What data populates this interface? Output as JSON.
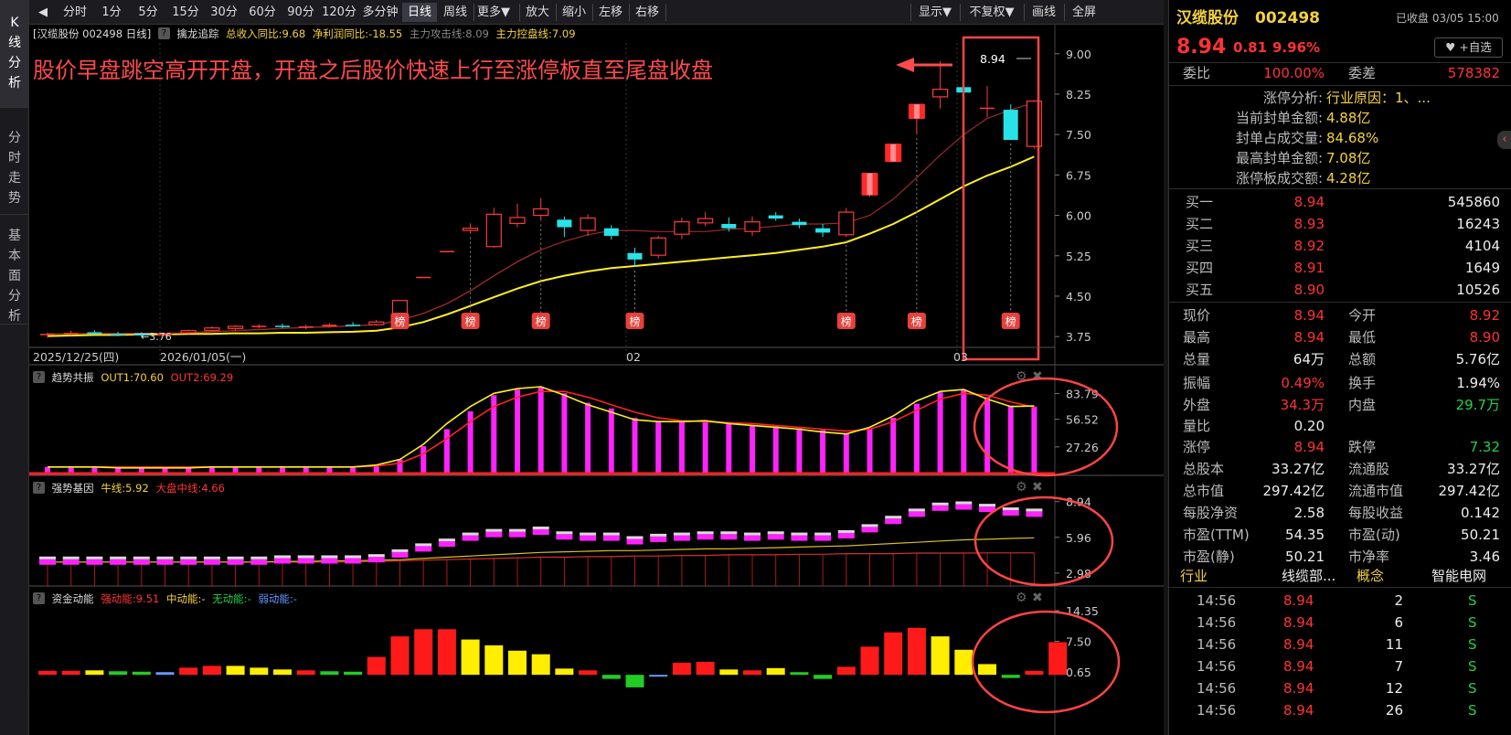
{
  "left_tabs": [
    {
      "chars": [
        "K",
        "线",
        "分",
        "析"
      ],
      "active": true
    },
    {
      "chars": [
        "分",
        "时",
        "走",
        "势"
      ],
      "active": false
    },
    {
      "chars": [
        "基",
        "本",
        "面",
        "分",
        "析"
      ],
      "active": false
    }
  ],
  "toolbar": {
    "back": "◀",
    "periods": [
      "分时",
      "1分",
      "5分",
      "15分",
      "30分",
      "60分",
      "90分",
      "120分",
      "多分钟",
      "日线",
      "周线",
      "更多▼"
    ],
    "active_period": "日线",
    "tools": [
      "放大",
      "缩小",
      "左移",
      "右移"
    ],
    "right": [
      "显示▼",
      "不复权▼",
      "画线",
      "全屏"
    ]
  },
  "main_pane": {
    "stock_label": "[汉缆股份 002498 日线]",
    "indicator": "擒龙追踪",
    "items": [
      {
        "text": "总收入同比:9.68",
        "color": "#f5d33d"
      },
      {
        "text": "净利润同比:-18.55",
        "color": "#f5d33d"
      },
      {
        "text": "主力攻击线:8.09",
        "color": "#888888"
      },
      {
        "text": "主力控盘线:7.09",
        "color": "#f5d33d"
      }
    ],
    "annotation": "股价早盘跳空高开开盘，开盘之后股价快速上行至涨停板直至尾盘收盘",
    "price_label": "8.94",
    "low_label": "3.76",
    "axis": [
      "9.00",
      "8.25",
      "7.50",
      "6.75",
      "6.00",
      "5.25",
      "4.50",
      "3.75"
    ],
    "dates": [
      "2025/12/25(四)",
      "2026/01/05(一)",
      "02",
      "03"
    ],
    "badge": "榜"
  },
  "pane2": {
    "name": "趋势共振",
    "out1": "OUT1:70.60",
    "out2": "OUT2:69.29",
    "axis": [
      "83.79",
      "56.52",
      "27.26"
    ]
  },
  "pane3": {
    "name": "强势基因",
    "l1": "牛线:5.92",
    "l2": "大盘中线:4.66",
    "axis": [
      "8.94",
      "5.96",
      "2.98"
    ]
  },
  "pane4": {
    "name": "资金动能",
    "l1": "强动能:9.51",
    "l2": "中动能:-",
    "l3": "无动能:-",
    "l4": "弱动能:-",
    "axis": [
      "14.35",
      "7.50",
      "0.65"
    ]
  },
  "chart_data": {
    "type": "candlestick",
    "candles": [
      {
        "o": 3.78,
        "h": 3.82,
        "l": 3.73,
        "c": 3.8
      },
      {
        "o": 3.8,
        "h": 3.86,
        "l": 3.77,
        "c": 3.82
      },
      {
        "o": 3.83,
        "h": 3.87,
        "l": 3.79,
        "c": 3.8
      },
      {
        "o": 3.8,
        "h": 3.84,
        "l": 3.76,
        "c": 3.79
      },
      {
        "o": 3.8,
        "h": 3.83,
        "l": 3.74,
        "c": 3.77
      },
      {
        "o": 3.78,
        "h": 3.82,
        "l": 3.76,
        "c": 3.8
      },
      {
        "o": 3.82,
        "h": 3.88,
        "l": 3.8,
        "c": 3.86
      },
      {
        "o": 3.86,
        "h": 3.94,
        "l": 3.84,
        "c": 3.91
      },
      {
        "o": 3.9,
        "h": 3.96,
        "l": 3.86,
        "c": 3.94
      },
      {
        "o": 3.93,
        "h": 3.98,
        "l": 3.9,
        "c": 3.95
      },
      {
        "o": 3.95,
        "h": 3.99,
        "l": 3.91,
        "c": 3.93
      },
      {
        "o": 3.92,
        "h": 3.97,
        "l": 3.88,
        "c": 3.94
      },
      {
        "o": 3.94,
        "h": 4.0,
        "l": 3.92,
        "c": 3.97
      },
      {
        "o": 3.97,
        "h": 4.02,
        "l": 3.94,
        "c": 3.96
      },
      {
        "o": 3.97,
        "h": 4.06,
        "l": 3.95,
        "c": 4.02
      },
      {
        "o": 4.1,
        "h": 4.42,
        "l": 4.08,
        "c": 4.42
      },
      {
        "o": 4.86,
        "h": 4.86,
        "l": 4.86,
        "c": 4.86
      },
      {
        "o": 5.34,
        "h": 5.34,
        "l": 5.34,
        "c": 5.34
      },
      {
        "o": 5.72,
        "h": 5.85,
        "l": 5.66,
        "c": 5.76
      },
      {
        "o": 5.42,
        "h": 6.14,
        "l": 5.4,
        "c": 6.02
      },
      {
        "o": 5.85,
        "h": 6.22,
        "l": 5.78,
        "c": 5.96
      },
      {
        "o": 6.0,
        "h": 6.32,
        "l": 5.9,
        "c": 6.12
      },
      {
        "o": 5.92,
        "h": 5.98,
        "l": 5.6,
        "c": 5.78
      },
      {
        "o": 5.72,
        "h": 6.02,
        "l": 5.62,
        "c": 5.95
      },
      {
        "o": 5.76,
        "h": 5.82,
        "l": 5.55,
        "c": 5.62
      },
      {
        "o": 5.3,
        "h": 5.4,
        "l": 5.04,
        "c": 5.18
      },
      {
        "o": 5.26,
        "h": 5.62,
        "l": 5.2,
        "c": 5.58
      },
      {
        "o": 5.65,
        "h": 5.96,
        "l": 5.56,
        "c": 5.88
      },
      {
        "o": 5.86,
        "h": 6.06,
        "l": 5.8,
        "c": 5.94
      },
      {
        "o": 5.84,
        "h": 5.96,
        "l": 5.7,
        "c": 5.76
      },
      {
        "o": 5.7,
        "h": 5.98,
        "l": 5.62,
        "c": 5.88
      },
      {
        "o": 6.0,
        "h": 6.06,
        "l": 5.9,
        "c": 5.94
      },
      {
        "o": 5.88,
        "h": 5.94,
        "l": 5.76,
        "c": 5.82
      },
      {
        "o": 5.76,
        "h": 5.84,
        "l": 5.6,
        "c": 5.68
      },
      {
        "o": 5.64,
        "h": 6.14,
        "l": 5.6,
        "c": 6.06
      },
      {
        "o": 6.38,
        "h": 6.78,
        "l": 6.34,
        "c": 6.78
      },
      {
        "o": 7.0,
        "h": 7.32,
        "l": 7.0,
        "c": 7.32
      },
      {
        "o": 7.8,
        "h": 8.06,
        "l": 7.5,
        "c": 8.06
      },
      {
        "o": 8.2,
        "h": 8.86,
        "l": 7.98,
        "c": 8.34
      },
      {
        "o": 8.38,
        "h": 8.44,
        "l": 8.16,
        "c": 8.28
      },
      {
        "o": 7.98,
        "h": 8.4,
        "l": 7.82,
        "c": 8.0
      },
      {
        "o": 7.96,
        "h": 8.06,
        "l": 7.4,
        "c": 7.4
      },
      {
        "o": 7.28,
        "h": 8.14,
        "l": 7.24,
        "c": 8.12
      }
    ],
    "ma_grey": [
      3.8,
      3.8,
      3.81,
      3.81,
      3.81,
      3.81,
      3.82,
      3.84,
      3.86,
      3.88,
      3.9,
      3.92,
      3.93,
      3.95,
      3.97,
      4.05,
      4.18,
      4.36,
      4.6,
      4.88,
      5.14,
      5.36,
      5.52,
      5.64,
      5.72,
      5.72,
      5.7,
      5.7,
      5.7,
      5.74,
      5.76,
      5.8,
      5.84,
      5.84,
      5.86,
      6.0,
      6.3,
      6.7,
      7.12,
      7.5,
      7.8,
      7.96,
      8.09
    ],
    "ma_yellow": [
      3.76,
      3.77,
      3.78,
      3.78,
      3.79,
      3.79,
      3.8,
      3.8,
      3.81,
      3.81,
      3.82,
      3.82,
      3.83,
      3.84,
      3.86,
      3.92,
      4.02,
      4.16,
      4.32,
      4.48,
      4.64,
      4.78,
      4.88,
      4.96,
      5.02,
      5.06,
      5.1,
      5.14,
      5.18,
      5.22,
      5.26,
      5.3,
      5.36,
      5.42,
      5.5,
      5.66,
      5.84,
      6.06,
      6.3,
      6.54,
      6.74,
      6.9,
      7.09
    ],
    "badges_at": [
      15,
      18,
      21,
      25,
      34,
      37,
      41
    ],
    "trend": {
      "bars": [
        6,
        6,
        6,
        5,
        5,
        5,
        5,
        6,
        6,
        6,
        6,
        6,
        6,
        6,
        8,
        14,
        28,
        46,
        65,
        82,
        88,
        91,
        84,
        74,
        68,
        58,
        54,
        54,
        55,
        52,
        50,
        49,
        47,
        45,
        42,
        47,
        58,
        73,
        85,
        88,
        80,
        71,
        70
      ],
      "out1": [
        6,
        6,
        6,
        5,
        5,
        5,
        5,
        6,
        6,
        6,
        6,
        6,
        6,
        6,
        8,
        14,
        30,
        52,
        70,
        84,
        89,
        91,
        82,
        72,
        64,
        56,
        54,
        54,
        55,
        52,
        50,
        48,
        46,
        43,
        41,
        48,
        60,
        76,
        86,
        88,
        78,
        70,
        70.6
      ],
      "out2": [
        6,
        6,
        6,
        6,
        6,
        6,
        6,
        6,
        6,
        6,
        6,
        6,
        6,
        6,
        7,
        10,
        20,
        36,
        54,
        70,
        80,
        86,
        86,
        80,
        72,
        64,
        58,
        55,
        54,
        53,
        52,
        50,
        48,
        46,
        44,
        46,
        54,
        66,
        78,
        84,
        82,
        75,
        69.3
      ]
    },
    "gene": {
      "boxes": [
        3.9,
        3.9,
        3.9,
        3.9,
        3.9,
        3.9,
        3.9,
        3.9,
        3.9,
        3.9,
        4.0,
        4.0,
        4.0,
        4.0,
        4.1,
        4.5,
        5.0,
        5.4,
        5.9,
        6.2,
        6.2,
        6.4,
        6.0,
        5.9,
        5.9,
        5.6,
        5.8,
        5.9,
        6.0,
        6.0,
        5.9,
        6.0,
        5.9,
        5.9,
        6.1,
        6.6,
        7.3,
        7.9,
        8.4,
        8.5,
        8.3,
        8.0,
        7.9
      ],
      "bull": [
        3.9,
        3.9,
        3.9,
        3.9,
        3.9,
        3.9,
        3.9,
        3.9,
        3.9,
        3.9,
        3.95,
        3.95,
        4.0,
        4.0,
        4.05,
        4.1,
        4.2,
        4.3,
        4.4,
        4.5,
        4.6,
        4.7,
        4.75,
        4.8,
        4.85,
        4.85,
        4.9,
        4.95,
        5.0,
        5.0,
        5.05,
        5.1,
        5.15,
        5.2,
        5.25,
        5.35,
        5.45,
        5.55,
        5.65,
        5.75,
        5.8,
        5.87,
        5.92
      ],
      "market": [
        3.9,
        3.9,
        3.9,
        3.9,
        3.9,
        3.9,
        3.9,
        3.9,
        3.9,
        3.9,
        3.9,
        3.9,
        3.9,
        3.9,
        3.95,
        4.0,
        4.05,
        4.1,
        4.15,
        4.2,
        4.25,
        4.3,
        4.3,
        4.35,
        4.35,
        4.4,
        4.4,
        4.45,
        4.45,
        4.5,
        4.5,
        4.5,
        4.55,
        4.55,
        4.6,
        4.6,
        4.6,
        4.65,
        4.65,
        4.65,
        4.66,
        4.66,
        4.66
      ]
    },
    "energy": [
      {
        "v": 0.9,
        "c": "#ff1a1a"
      },
      {
        "v": 0.9,
        "c": "#ff1a1a"
      },
      {
        "v": 1.0,
        "c": "#ffee00"
      },
      {
        "v": 0.8,
        "c": "#22cc22"
      },
      {
        "v": 0.7,
        "c": "#22cc22"
      },
      {
        "v": 0.6,
        "c": "#6699ff"
      },
      {
        "v": 1.6,
        "c": "#ff1a1a"
      },
      {
        "v": 2.0,
        "c": "#ff1a1a"
      },
      {
        "v": 2.0,
        "c": "#ffee00"
      },
      {
        "v": 1.6,
        "c": "#ffee00"
      },
      {
        "v": 1.2,
        "c": "#ffee00"
      },
      {
        "v": 1.0,
        "c": "#ff1a1a"
      },
      {
        "v": 0.8,
        "c": "#22cc22"
      },
      {
        "v": 0.7,
        "c": "#22cc22"
      },
      {
        "v": 4.0,
        "c": "#ff1a1a"
      },
      {
        "v": 8.6,
        "c": "#ff1a1a"
      },
      {
        "v": 10.2,
        "c": "#ff1a1a"
      },
      {
        "v": 10.2,
        "c": "#ff1a1a"
      },
      {
        "v": 7.9,
        "c": "#ffee00"
      },
      {
        "v": 6.6,
        "c": "#ffee00"
      },
      {
        "v": 5.4,
        "c": "#ffee00"
      },
      {
        "v": 4.6,
        "c": "#ffee00"
      },
      {
        "v": 1.4,
        "c": "#ffee00"
      },
      {
        "v": 1.0,
        "c": "#ff1a1a"
      },
      {
        "v": -0.9,
        "c": "#22cc22"
      },
      {
        "v": -2.8,
        "c": "#22cc22"
      },
      {
        "v": -0.4,
        "c": "#6699ff"
      },
      {
        "v": 2.7,
        "c": "#ff1a1a"
      },
      {
        "v": 2.9,
        "c": "#ff1a1a"
      },
      {
        "v": 1.2,
        "c": "#ffee00"
      },
      {
        "v": 1.0,
        "c": "#ff1a1a"
      },
      {
        "v": 1.5,
        "c": "#ffee00"
      },
      {
        "v": 0.6,
        "c": "#22cc22"
      },
      {
        "v": -0.9,
        "c": "#22cc22"
      },
      {
        "v": 1.8,
        "c": "#ff1a1a"
      },
      {
        "v": 6.3,
        "c": "#ff1a1a"
      },
      {
        "v": 9.5,
        "c": "#ff1a1a"
      },
      {
        "v": 10.5,
        "c": "#ff1a1a"
      },
      {
        "v": 8.6,
        "c": "#ffee00"
      },
      {
        "v": 5.6,
        "c": "#ffee00"
      },
      {
        "v": 2.4,
        "c": "#ffee00"
      },
      {
        "v": -0.7,
        "c": "#22cc22"
      },
      {
        "v": 0.9,
        "c": "#ff1a1a"
      },
      {
        "v": 7.3,
        "c": "#ff1a1a"
      }
    ]
  },
  "quote": {
    "name": "汉缆股份",
    "code": "002498",
    "status": "已收盘 03/05 15:00",
    "price": "8.94",
    "change": "0.81",
    "change_pct": "9.96%",
    "add_fav": "+自选",
    "webi_label": "委比",
    "webi": "100.00%",
    "weicha_label": "委差",
    "weicha": "578382",
    "limit_items": [
      {
        "label": "涨停分析:",
        "value": "行业原因：1、..."
      },
      {
        "label": "当前封单金额:",
        "value": "4.88亿"
      },
      {
        "label": "封单占成交量:",
        "value": "84.68%"
      },
      {
        "label": "最高封单金额:",
        "value": "7.08亿"
      },
      {
        "label": "涨停板成交额:",
        "value": "4.28亿"
      }
    ],
    "bids": [
      {
        "label": "买一",
        "price": "8.94",
        "vol": "545860"
      },
      {
        "label": "买二",
        "price": "8.93",
        "vol": "16243"
      },
      {
        "label": "买三",
        "price": "8.92",
        "vol": "4104"
      },
      {
        "label": "买四",
        "price": "8.91",
        "vol": "1649"
      },
      {
        "label": "买五",
        "price": "8.90",
        "vol": "10526"
      }
    ],
    "stats": [
      {
        "l1": "现价",
        "v1": "8.94",
        "c1": "red",
        "l2": "今开",
        "v2": "8.92",
        "c2": "red"
      },
      {
        "l1": "最高",
        "v1": "8.94",
        "c1": "red",
        "l2": "最低",
        "v2": "8.90",
        "c2": "red"
      },
      {
        "l1": "总量",
        "v1": "64万",
        "c1": "white",
        "l2": "总额",
        "v2": "5.76亿",
        "c2": "white"
      },
      {
        "l1": "振幅",
        "v1": "0.49%",
        "c1": "red",
        "l2": "换手",
        "v2": "1.94%",
        "c2": "white"
      },
      {
        "l1": "外盘",
        "v1": "34.3万",
        "c1": "red",
        "l2": "内盘",
        "v2": "29.7万",
        "c2": "green"
      },
      {
        "l1": "量比",
        "v1": "0.20",
        "c1": "white",
        "l2": "",
        "v2": "",
        "c2": "white"
      },
      {
        "l1": "涨停",
        "v1": "8.94",
        "c1": "red",
        "l2": "跌停",
        "v2": "7.32",
        "c2": "green"
      },
      {
        "l1": "总股本",
        "v1": "33.27亿",
        "c1": "white",
        "l2": "流通股",
        "v2": "33.27亿",
        "c2": "white"
      },
      {
        "l1": "总市值",
        "v1": "297.42亿",
        "c1": "white",
        "l2": "流通市值",
        "v2": "297.42亿",
        "c2": "white"
      },
      {
        "l1": "每股净资",
        "v1": "2.58",
        "c1": "white",
        "l2": "每股收益",
        "v2": "0.142",
        "c2": "white"
      },
      {
        "l1": "市盈(TTM)",
        "v1": "54.35",
        "c1": "white",
        "l2": "市盈(动)",
        "v2": "50.21",
        "c2": "white"
      },
      {
        "l1": "市盈(静)",
        "v1": "50.21",
        "c1": "white",
        "l2": "市净率",
        "v2": "3.46",
        "c2": "white"
      }
    ],
    "industry_label": "行业",
    "industry": "线缆部...",
    "concept_label": "概念",
    "concept": "智能电网",
    "ticks": [
      {
        "t": "14:56",
        "p": "8.94",
        "v": "2",
        "f": "S"
      },
      {
        "t": "14:56",
        "p": "8.94",
        "v": "6",
        "f": "S"
      },
      {
        "t": "14:56",
        "p": "8.94",
        "v": "11",
        "f": "S"
      },
      {
        "t": "14:56",
        "p": "8.94",
        "v": "7",
        "f": "S"
      },
      {
        "t": "14:56",
        "p": "8.94",
        "v": "12",
        "f": "S"
      },
      {
        "t": "14:56",
        "p": "8.94",
        "v": "26",
        "f": "S"
      }
    ]
  }
}
